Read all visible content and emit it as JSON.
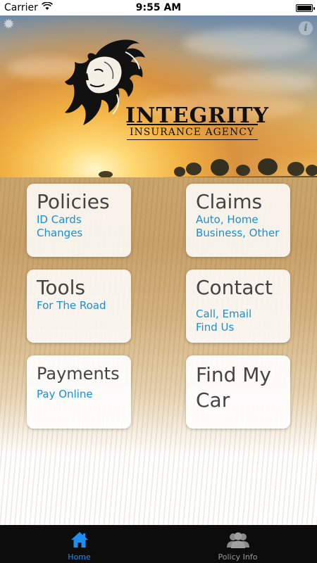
{
  "status_bar": {
    "carrier": "Carrier",
    "time": "9:55 AM"
  },
  "logo": {
    "title": "INTEGRITY",
    "subtitle": "INSURANCE AGENCY"
  },
  "tiles": [
    {
      "title": "Policies",
      "lines": [
        "ID Cards",
        "Changes"
      ]
    },
    {
      "title": "Claims",
      "lines": [
        "Auto, Home",
        "Business, Other"
      ]
    },
    {
      "title": "Tools",
      "lines": [
        "For The Road"
      ]
    },
    {
      "title": "Contact",
      "lines": [
        "Call, Email",
        "Find Us"
      ]
    },
    {
      "title": "Payments",
      "lines": [
        "Pay Online"
      ]
    },
    {
      "title_lines": [
        "Find My",
        "Car"
      ]
    }
  ],
  "tab_bar": {
    "tabs": [
      {
        "label": "Home",
        "icon": "home-icon",
        "active": true
      },
      {
        "label": "Policy Info",
        "icon": "users-icon",
        "active": false
      }
    ]
  },
  "colors": {
    "accent": "#1e8ff0",
    "tile_subtitle": "#1a8ed6",
    "tile_title": "#444444",
    "tab_bar_bg": "#0c0c0c"
  }
}
